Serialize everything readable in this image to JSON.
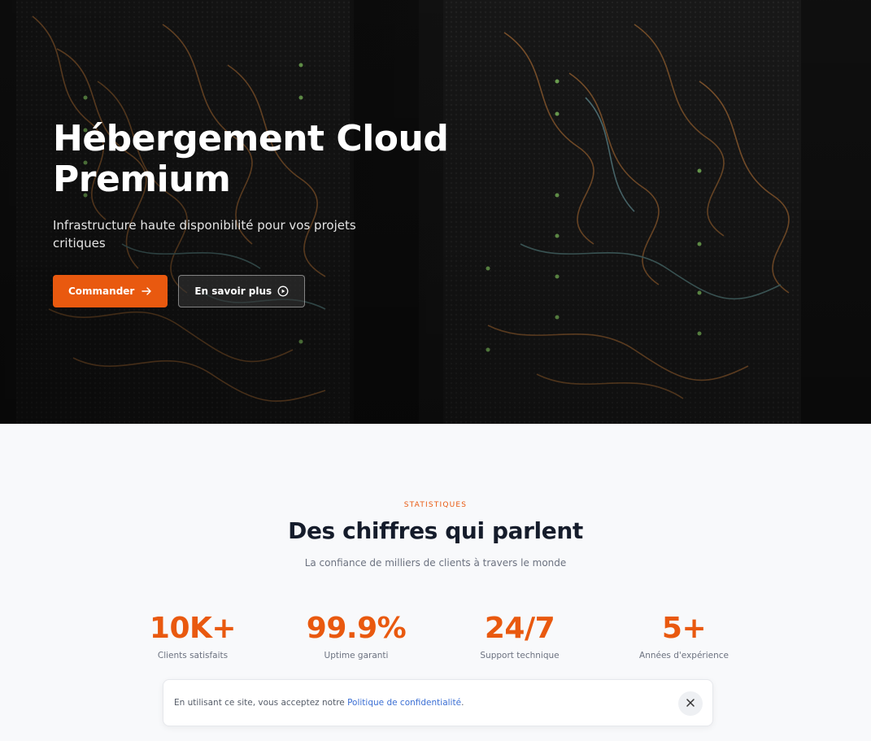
{
  "hero": {
    "title_line1": "Hébergement Cloud",
    "title_line2": "Premium",
    "subtitle": "Infrastructure haute disponibilité pour vos projets critiques",
    "primary_cta": "Commander",
    "secondary_cta": "En savoir plus"
  },
  "stats_section": {
    "eyebrow": "STATISTIQUES",
    "title": "Des chiffres qui parlent",
    "subtitle": "La confiance de milliers de clients à travers le monde",
    "items": [
      {
        "value": "10K+",
        "label": "Clients satisfaits"
      },
      {
        "value": "99.9%",
        "label": "Uptime garanti"
      },
      {
        "value": "24/7",
        "label": "Support technique"
      },
      {
        "value": "5+",
        "label": "Années d'expérience"
      }
    ]
  },
  "cookie_banner": {
    "text": "En utilisant ce site, vous acceptez notre ",
    "link": "Politique de confidentialité",
    "suffix": "."
  },
  "colors": {
    "accent": "#e9590f",
    "heading": "#151c2b",
    "muted": "#6c7280",
    "link": "#3b6fd4"
  },
  "icons": {
    "primary_cta": "arrow-right-icon",
    "secondary_cta": "play-circle-icon",
    "cookie_close": "close-icon"
  }
}
